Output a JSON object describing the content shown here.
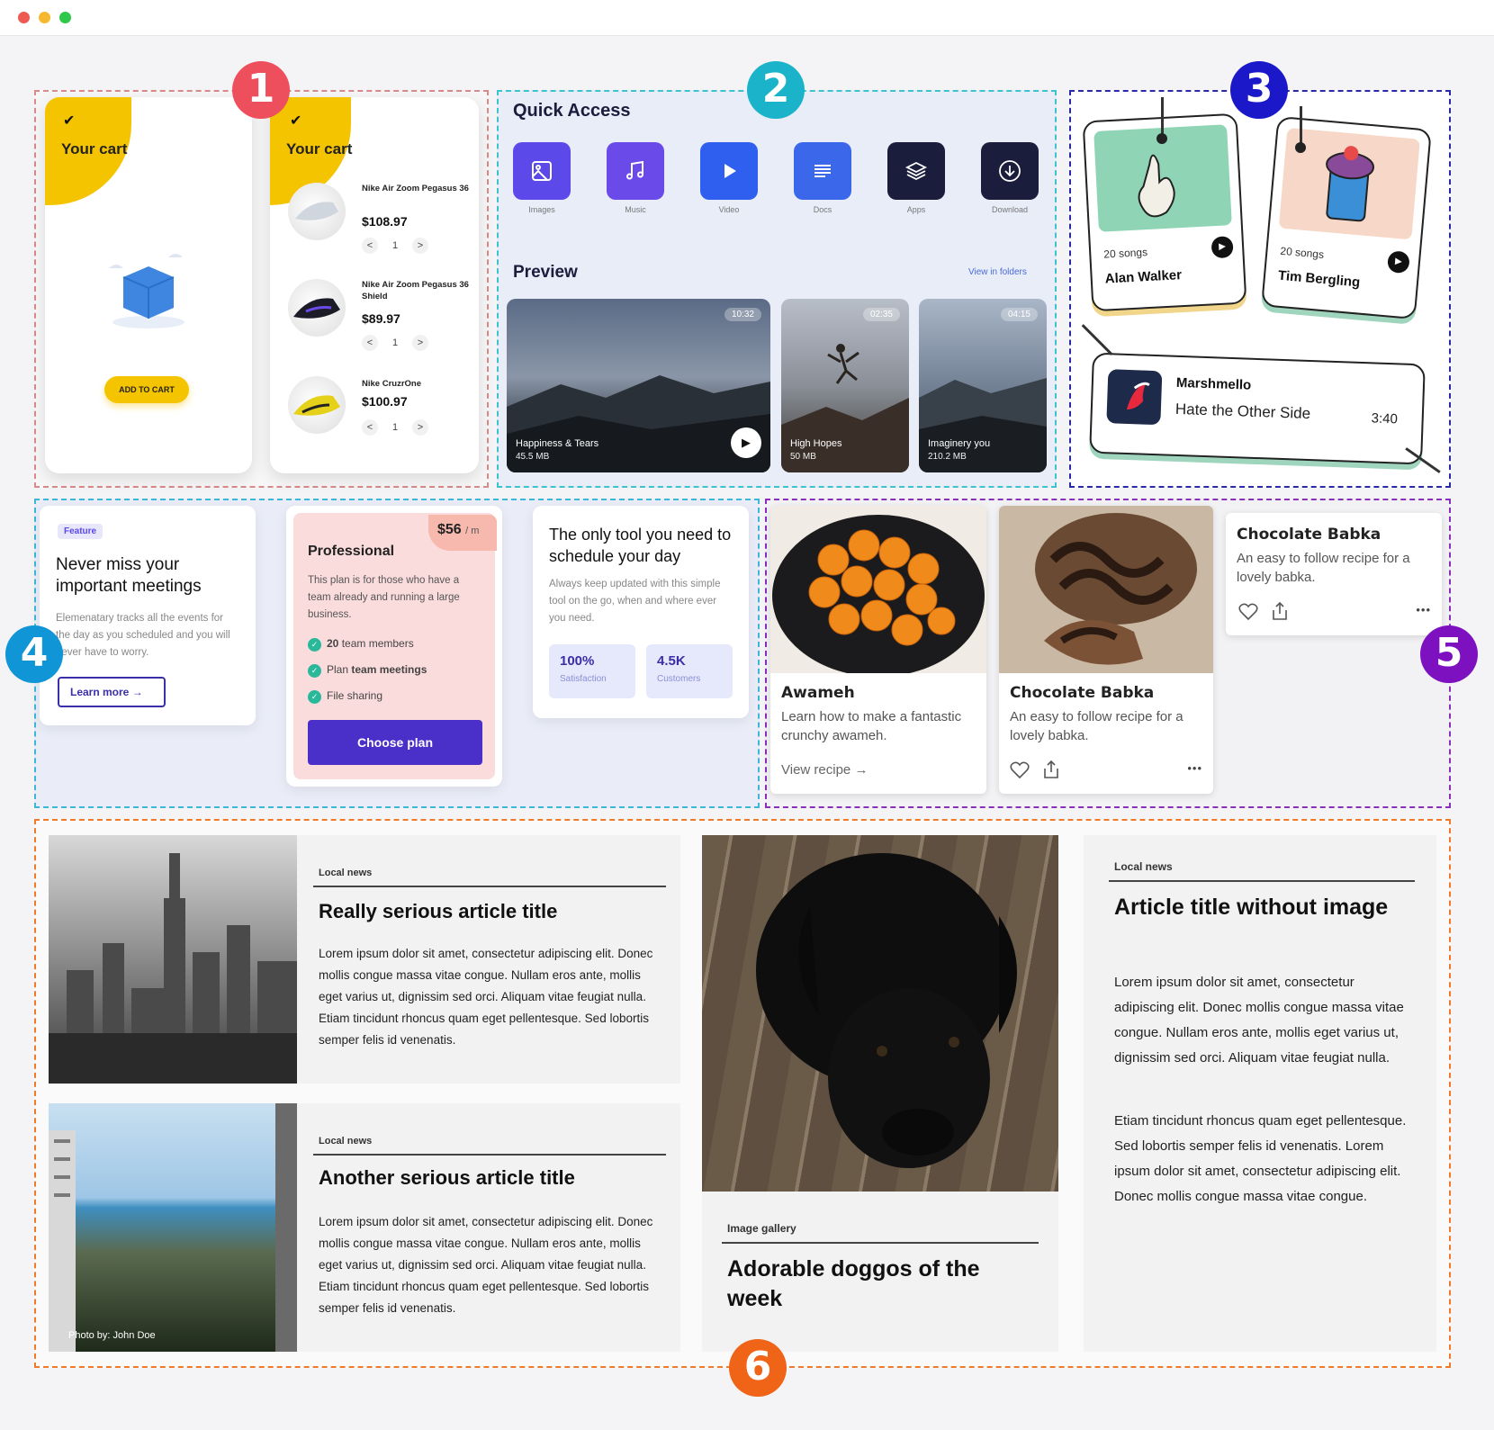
{
  "window": {
    "controls": [
      "close",
      "minimize",
      "maximize"
    ],
    "colors": [
      "#ee5a52",
      "#f5b82e",
      "#2fc84a"
    ]
  },
  "badges": [
    "1",
    "2",
    "3",
    "4",
    "5",
    "6"
  ],
  "badge_colors": [
    "#ee4f5c",
    "#1bb3c9",
    "#1a18c9",
    "#1096d6",
    "#7d10bf",
    "#f06418"
  ],
  "cart": {
    "title": "Your cart",
    "empty_button": "ADD TO CART",
    "items": [
      {
        "name": "Nike Air Zoom Pegasus 36",
        "price": "$108.97",
        "qty": "1"
      },
      {
        "name": "Nike Air Zoom Pegasus 36 Shield",
        "price": "$89.97",
        "qty": "1"
      },
      {
        "name": "Nike CruzrOne",
        "price": "$100.97",
        "qty": "1"
      }
    ],
    "dec": "<",
    "inc": ">"
  },
  "quick": {
    "title": "Quick Access",
    "tiles": [
      {
        "label": "Images",
        "icon": "image-icon",
        "color": "#5b49ea"
      },
      {
        "label": "Music",
        "icon": "music-icon",
        "color": "#6a4ae8"
      },
      {
        "label": "Video",
        "icon": "play-icon",
        "color": "#2f5fef"
      },
      {
        "label": "Docs",
        "icon": "docs-icon",
        "color": "#3b67ea"
      },
      {
        "label": "Apps",
        "icon": "layers-icon",
        "color": "#1a1d3c"
      },
      {
        "label": "Download",
        "icon": "download-icon",
        "color": "#1a1d3c"
      }
    ],
    "preview_title": "Preview",
    "view_link": "View in folders",
    "videos": [
      {
        "name": "Happiness & Tears",
        "size": "45.5 MB",
        "time": "10:32"
      },
      {
        "name": "High Hopes",
        "size": "50 MB",
        "time": "02:35"
      },
      {
        "name": "Imaginery you",
        "size": "210.2 MB",
        "time": "04:15"
      }
    ]
  },
  "music": {
    "cards": [
      {
        "songs": "20 songs",
        "artist": "Alan Walker"
      },
      {
        "songs": "20 songs",
        "artist": "Tim Bergling"
      }
    ],
    "wide": {
      "artist": "Marshmello",
      "track": "Hate the Other Side",
      "duration": "3:40"
    }
  },
  "features": {
    "tag": "Feature",
    "title": "Never miss your important meetings",
    "body": "Elemenatary tracks all the events for the day as you scheduled and you will never have to worry.",
    "learn": "Learn more",
    "plan": {
      "price": "$56",
      "per": "/ m",
      "name": "Professional",
      "desc": "This plan is for those who have a team already and running a large business.",
      "features": [
        {
          "bold": "20",
          "rest": " team members"
        },
        {
          "pre": "Plan ",
          "bold": "team meetings"
        },
        {
          "rest": "File sharing"
        }
      ],
      "cta": "Choose plan"
    },
    "tool": {
      "title": "The only tool you need to schedule your day",
      "body": "Always keep updated with this simple tool on the go, when and where ever you need.",
      "stats": [
        {
          "value": "100%",
          "label": "Satisfaction"
        },
        {
          "value": "4.5K",
          "label": "Customers"
        }
      ]
    }
  },
  "recipes": {
    "items": [
      {
        "title": "Awameh",
        "desc": "Learn how to make a fantastic crunchy awameh.",
        "link": "View recipe"
      },
      {
        "title": "Chocolate Babka",
        "desc": "An easy to follow recipe for a lovely babka."
      },
      {
        "title": "Chocolate Babka",
        "desc": "An easy to follow recipe for a lovely babka."
      }
    ],
    "more": "•••"
  },
  "news": {
    "a1": {
      "kicker": "Local news",
      "title": "Really serious article title",
      "body": "Lorem ipsum dolor sit amet, consectetur adipiscing elit. Donec mollis congue massa vitae congue. Nullam eros ante, mollis eget varius ut, dignissim sed orci. Aliquam vitae feugiat nulla. Etiam tincidunt rhoncus quam eget pellentesque. Sed lobortis semper felis id venenatis."
    },
    "a2": {
      "kicker": "Local news",
      "title": "Another serious article title",
      "body": "Lorem ipsum dolor sit amet, consectetur adipiscing elit. Donec mollis congue massa vitae congue. Nullam eros ante, mollis eget varius ut, dignissim sed orci. Aliquam vitae feugiat nulla. Etiam tincidunt rhoncus quam eget pellentesque. Sed lobortis semper felis id venenatis.",
      "credit": "Photo by: John Doe"
    },
    "gallery": {
      "kicker": "Image gallery",
      "title": "Adorable doggos of the week"
    },
    "a3": {
      "kicker": "Local news",
      "title": "Article title without image",
      "body1": "Lorem ipsum dolor sit amet, consectetur adipiscing elit. Donec mollis congue massa vitae congue. Nullam eros ante, mollis eget varius ut, dignissim sed orci. Aliquam vitae feugiat nulla.",
      "body2": "Etiam tincidunt rhoncus quam eget pellentesque. Sed lobortis semper felis id venenatis. Lorem ipsum dolor sit amet, consectetur adipiscing elit. Donec mollis congue massa vitae congue."
    }
  }
}
